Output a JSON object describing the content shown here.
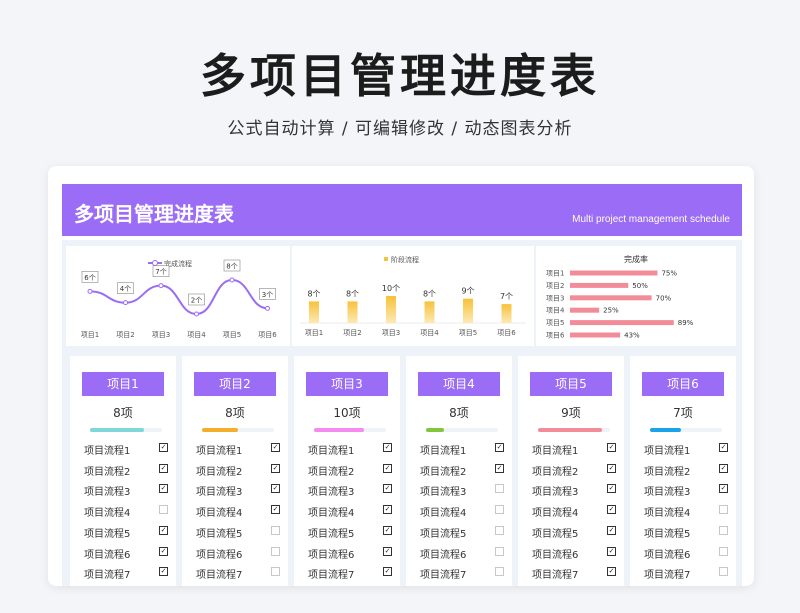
{
  "header": {
    "title": "多项目管理进度表",
    "subtitle": "公式自动计算 /  可编辑修改  / 动态图表分析"
  },
  "banner": {
    "title": "多项目管理进度表",
    "subtitle": "Multi project management schedule"
  },
  "colors": {
    "accent": "#9b6cf5",
    "line": "#9b6cf5",
    "bar_gold": "#f7c23a",
    "bar_pink": "#f28c98"
  },
  "chart_data": [
    {
      "type": "line",
      "legend": "完成流程",
      "categories": [
        "项目1",
        "项目2",
        "项目3",
        "项目4",
        "项目5",
        "项目6"
      ],
      "values": [
        6,
        4,
        7,
        2,
        8,
        3
      ],
      "value_labels": [
        "6个",
        "4个",
        "7个",
        "2个",
        "8个",
        "3个"
      ]
    },
    {
      "type": "bar",
      "legend": "阶段流程",
      "categories": [
        "项目1",
        "项目2",
        "项目3",
        "项目4",
        "项目5",
        "项目6"
      ],
      "values": [
        8,
        8,
        10,
        8,
        9,
        7
      ],
      "value_labels": [
        "8个",
        "8个",
        "10个",
        "8个",
        "9个",
        "7个"
      ]
    },
    {
      "type": "bar",
      "orientation": "horizontal",
      "title": "完成率",
      "categories": [
        "项目1",
        "项目2",
        "项目3",
        "项目4",
        "项目5",
        "项目6"
      ],
      "values": [
        75,
        50,
        70,
        25,
        89,
        43
      ],
      "value_labels": [
        "75%",
        "50%",
        "70%",
        "25%",
        "89%",
        "43%"
      ]
    }
  ],
  "projects": [
    {
      "name": "项目1",
      "count": "8项",
      "progress": 0.75,
      "color": "#7ed8d8",
      "steps": [
        {
          "label": "项目流程1",
          "done": true
        },
        {
          "label": "项目流程2",
          "done": true
        },
        {
          "label": "项目流程3",
          "done": true
        },
        {
          "label": "项目流程4",
          "done": false
        },
        {
          "label": "项目流程5",
          "done": true
        },
        {
          "label": "项目流程6",
          "done": true
        },
        {
          "label": "项目流程7",
          "done": true
        }
      ]
    },
    {
      "name": "项目2",
      "count": "8项",
      "progress": 0.5,
      "color": "#f4ae2b",
      "steps": [
        {
          "label": "项目流程1",
          "done": true
        },
        {
          "label": "项目流程2",
          "done": true
        },
        {
          "label": "项目流程3",
          "done": true
        },
        {
          "label": "项目流程4",
          "done": true
        },
        {
          "label": "项目流程5",
          "done": false
        },
        {
          "label": "项目流程6",
          "done": false
        },
        {
          "label": "项目流程7",
          "done": false
        }
      ]
    },
    {
      "name": "项目3",
      "count": "10项",
      "progress": 0.7,
      "color": "#f58bf1",
      "steps": [
        {
          "label": "项目流程1",
          "done": true
        },
        {
          "label": "项目流程2",
          "done": true
        },
        {
          "label": "项目流程3",
          "done": true
        },
        {
          "label": "项目流程4",
          "done": true
        },
        {
          "label": "项目流程5",
          "done": true
        },
        {
          "label": "项目流程6",
          "done": true
        },
        {
          "label": "项目流程7",
          "done": true
        }
      ]
    },
    {
      "name": "项目4",
      "count": "8项",
      "progress": 0.25,
      "color": "#83c63c",
      "steps": [
        {
          "label": "项目流程1",
          "done": true
        },
        {
          "label": "项目流程2",
          "done": true
        },
        {
          "label": "项目流程3",
          "done": false
        },
        {
          "label": "项目流程4",
          "done": false
        },
        {
          "label": "项目流程5",
          "done": false
        },
        {
          "label": "项目流程6",
          "done": false
        },
        {
          "label": "项目流程7",
          "done": false
        }
      ]
    },
    {
      "name": "项目5",
      "count": "9项",
      "progress": 0.89,
      "color": "#f28c98",
      "steps": [
        {
          "label": "项目流程1",
          "done": true
        },
        {
          "label": "项目流程2",
          "done": true
        },
        {
          "label": "项目流程3",
          "done": true
        },
        {
          "label": "项目流程4",
          "done": true
        },
        {
          "label": "项目流程5",
          "done": true
        },
        {
          "label": "项目流程6",
          "done": true
        },
        {
          "label": "项目流程7",
          "done": true
        }
      ]
    },
    {
      "name": "项目6",
      "count": "7项",
      "progress": 0.43,
      "color": "#1ba3e8",
      "steps": [
        {
          "label": "项目流程1",
          "done": true
        },
        {
          "label": "项目流程2",
          "done": true
        },
        {
          "label": "项目流程3",
          "done": true
        },
        {
          "label": "项目流程4",
          "done": false
        },
        {
          "label": "项目流程5",
          "done": false
        },
        {
          "label": "项目流程6",
          "done": false
        },
        {
          "label": "项目流程7",
          "done": false
        }
      ]
    }
  ]
}
